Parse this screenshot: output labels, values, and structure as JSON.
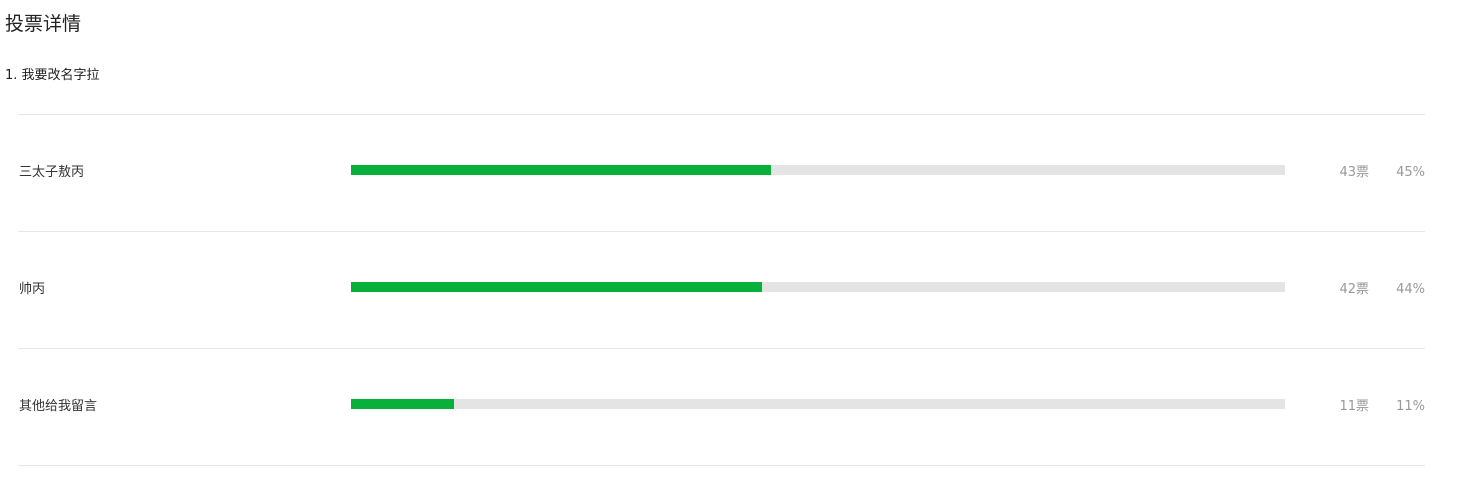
{
  "page": {
    "title": "投票详情"
  },
  "question": {
    "text": "1. 我要改名字拉"
  },
  "colors": {
    "bar_fill": "#07b03b",
    "bar_track": "#e4e4e4",
    "divider": "#e6e6e6",
    "secondary_text": "#999999"
  },
  "options": [
    {
      "label": "三太子敖丙",
      "votes": "43票",
      "percent": "45%",
      "fraction": 0.45
    },
    {
      "label": "帅丙",
      "votes": "42票",
      "percent": "44%",
      "fraction": 0.44
    },
    {
      "label": "其他给我留言",
      "votes": "11票",
      "percent": "11%",
      "fraction": 0.11
    }
  ]
}
